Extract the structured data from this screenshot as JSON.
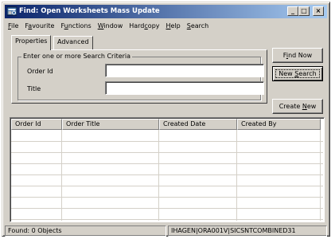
{
  "window": {
    "title": "Find: Open Worksheets Mass Update",
    "minimize": "_",
    "maximize": "□",
    "close": "×"
  },
  "menu": [
    {
      "pre": "",
      "key": "F",
      "post": "ile"
    },
    {
      "pre": "F",
      "key": "a",
      "post": "vourite"
    },
    {
      "pre": "F",
      "key": "u",
      "post": "nctions"
    },
    {
      "pre": "",
      "key": "W",
      "post": "indow"
    },
    {
      "pre": "Hard",
      "key": "c",
      "post": "opy"
    },
    {
      "pre": "",
      "key": "H",
      "post": "elp"
    },
    {
      "pre": "",
      "key": "S",
      "post": "earch"
    }
  ],
  "tabs": {
    "properties": "Properties",
    "advanced": "Advanced"
  },
  "criteria": {
    "group_label": "Enter one or more Search Criteria",
    "order_id_label": "Order Id",
    "order_id_value": "",
    "title_label": "Title",
    "title_value": ""
  },
  "buttons": {
    "find_now": {
      "pre": "F",
      "key": "i",
      "post": "nd Now"
    },
    "new_search": {
      "pre": "New ",
      "key": "S",
      "post": "earch"
    },
    "create_new": {
      "pre": "Create ",
      "key": "N",
      "post": "ew"
    }
  },
  "table": {
    "columns": [
      "Order Id",
      "Order Title",
      "Created Date",
      "Created By"
    ],
    "rows": []
  },
  "status": {
    "found": "Found: 0 Objects",
    "connection": "IHAGEN|ORA001V|SICSNTCOMBINED31"
  },
  "colors": {
    "title_start": "#0a246a",
    "title_end": "#a6caf0",
    "face": "#d4d0c8"
  }
}
